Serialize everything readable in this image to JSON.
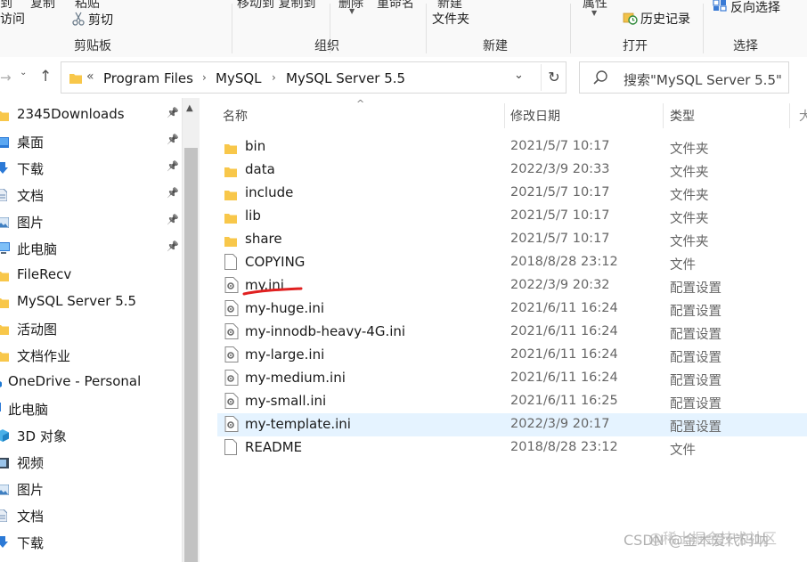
{
  "ribbon": {
    "cut_texts": [
      "到",
      "复制",
      "粘贴",
      "移动到 复制到",
      "删除",
      "重命名",
      "新建",
      "属性",
      "反向选择"
    ],
    "access": "访问",
    "scissors_label": "剪切",
    "new_folder": "文件夹",
    "history": "历史记录",
    "reverse_select": "反向选择",
    "groups": {
      "clipboard": "剪贴板",
      "organize": "组织",
      "new": "新建",
      "open": "打开",
      "select": "选择"
    }
  },
  "address": {
    "overflow": "«",
    "crumbs": [
      "Program Files",
      "MySQL",
      "MySQL Server 5.5"
    ],
    "search_placeholder": "搜索\"MySQL Server 5.5\""
  },
  "navpane": {
    "items": [
      {
        "label": "2345Downloads",
        "icon": "folder-icon",
        "pinned": true
      },
      {
        "label": "桌面",
        "icon": "desktop-icon",
        "pinned": true
      },
      {
        "label": "下载",
        "icon": "download-icon",
        "pinned": true
      },
      {
        "label": "文档",
        "icon": "document-icon",
        "pinned": true
      },
      {
        "label": "图片",
        "icon": "picture-icon",
        "pinned": true
      },
      {
        "label": "此电脑",
        "icon": "computer-icon",
        "pinned": true
      },
      {
        "label": "FileRecv",
        "icon": "folder-icon",
        "pinned": false
      },
      {
        "label": "MySQL Server 5.5",
        "icon": "folder-icon",
        "pinned": false
      },
      {
        "label": "活动图",
        "icon": "folder-icon",
        "pinned": false
      },
      {
        "label": "文档作业",
        "icon": "folder-icon",
        "pinned": false
      },
      {
        "label": "OneDrive - Personal",
        "icon": "cloud-icon",
        "pinned": false
      },
      {
        "label": "此电脑",
        "icon": "computer-icon",
        "pinned": false
      },
      {
        "label": "3D 对象",
        "icon": "cube-icon",
        "pinned": false
      },
      {
        "label": "视频",
        "icon": "video-icon",
        "pinned": false
      },
      {
        "label": "图片",
        "icon": "picture-icon",
        "pinned": false
      },
      {
        "label": "文档",
        "icon": "document-icon",
        "pinned": false
      },
      {
        "label": "下载",
        "icon": "download-icon",
        "pinned": false
      }
    ]
  },
  "columns": {
    "name": "名称",
    "date": "修改日期",
    "type": "类型",
    "size": "大"
  },
  "files": [
    {
      "name": "bin",
      "date": "2021/5/7 10:17",
      "type": "文件夹",
      "kind": "folder"
    },
    {
      "name": "data",
      "date": "2022/3/9 20:33",
      "type": "文件夹",
      "kind": "folder"
    },
    {
      "name": "include",
      "date": "2021/5/7 10:17",
      "type": "文件夹",
      "kind": "folder"
    },
    {
      "name": "lib",
      "date": "2021/5/7 10:17",
      "type": "文件夹",
      "kind": "folder"
    },
    {
      "name": "share",
      "date": "2021/5/7 10:17",
      "type": "文件夹",
      "kind": "folder"
    },
    {
      "name": "COPYING",
      "date": "2018/8/28 23:12",
      "type": "文件",
      "kind": "file"
    },
    {
      "name": "my.ini",
      "date": "2022/3/9 20:32",
      "type": "配置设置",
      "kind": "ini"
    },
    {
      "name": "my-huge.ini",
      "date": "2021/6/11 16:24",
      "type": "配置设置",
      "kind": "ini"
    },
    {
      "name": "my-innodb-heavy-4G.ini",
      "date": "2021/6/11 16:24",
      "type": "配置设置",
      "kind": "ini"
    },
    {
      "name": "my-large.ini",
      "date": "2021/6/11 16:24",
      "type": "配置设置",
      "kind": "ini"
    },
    {
      "name": "my-medium.ini",
      "date": "2021/6/11 16:24",
      "type": "配置设置",
      "kind": "ini"
    },
    {
      "name": "my-small.ini",
      "date": "2021/6/11 16:25",
      "type": "配置设置",
      "kind": "ini"
    },
    {
      "name": "my-template.ini",
      "date": "2022/3/9 20:17",
      "type": "配置设置",
      "kind": "ini",
      "selected": true
    },
    {
      "name": "README",
      "date": "2018/8/28 23:12",
      "type": "文件",
      "kind": "file"
    }
  ],
  "watermark": "CSDN @金木爱代码呐",
  "watermark2": "@稀土掘金技术社区",
  "colors": {
    "folder": "#f8c74a",
    "selected_row": "#e5f3ff",
    "annotation": "#e02020"
  }
}
